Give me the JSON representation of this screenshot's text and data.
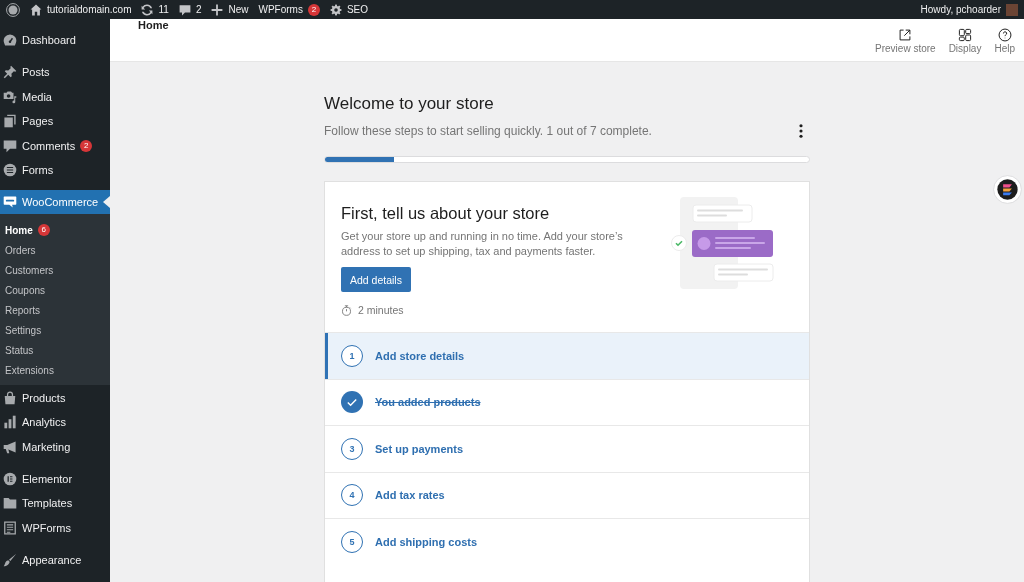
{
  "admin_bar": {
    "site_name": "tutorialdomain.com",
    "updates_count": "11",
    "comments_count": "2",
    "new_label": "New",
    "wpforms": {
      "label": "WPForms",
      "badge": "2"
    },
    "seo_label": "SEO",
    "greeting": "Howdy, pchoarder"
  },
  "sidebar": {
    "groups": [
      {
        "items": [
          {
            "label": "Dashboard",
            "selected": false
          }
        ]
      },
      {
        "items": [
          {
            "label": "Posts",
            "selected": false
          },
          {
            "label": "Media",
            "selected": false
          },
          {
            "label": "Pages",
            "selected": false
          },
          {
            "label": "Comments",
            "selected": false,
            "badge": "2"
          },
          {
            "label": "Forms",
            "selected": false
          }
        ]
      },
      {
        "items": [
          {
            "label": "WooCommerce",
            "selected": true,
            "expanded": true,
            "children": [
              {
                "label": "Home",
                "selected": true,
                "badge": "6"
              },
              {
                "label": "Orders",
                "selected": false
              },
              {
                "label": "Customers",
                "selected": false
              },
              {
                "label": "Coupons",
                "selected": false
              },
              {
                "label": "Reports",
                "selected": false
              },
              {
                "label": "Settings",
                "selected": false
              },
              {
                "label": "Status",
                "selected": false
              },
              {
                "label": "Extensions",
                "selected": false
              }
            ]
          },
          {
            "label": "Products",
            "selected": false
          },
          {
            "label": "Analytics",
            "selected": false
          },
          {
            "label": "Marketing",
            "selected": false
          }
        ]
      },
      {
        "items": [
          {
            "label": "Elementor",
            "selected": false
          },
          {
            "label": "Templates",
            "selected": false
          },
          {
            "label": "WPForms",
            "selected": false
          }
        ]
      },
      {
        "items": [
          {
            "label": "Appearance",
            "selected": false
          }
        ]
      }
    ]
  },
  "header": {
    "title": "Home",
    "actions": [
      {
        "label": "Preview store"
      },
      {
        "label": "Display"
      },
      {
        "label": "Help"
      }
    ]
  },
  "welcome": {
    "title": "Welcome to your store",
    "subtitle": "Follow these steps to start selling quickly. 1 out of 7 complete.",
    "progress": {
      "level": 0.143
    },
    "card": {
      "title": "First, tell us about your store",
      "description": "Get your store up and running in no time. Add your store’s address to set up shipping, tax and payments faster.",
      "button": "Add details",
      "duration": "2 minutes"
    },
    "tasks": [
      {
        "number": "1",
        "label": "Add store details",
        "selected": true,
        "completed": false
      },
      {
        "label": "You added products",
        "selected": false,
        "completed": true
      },
      {
        "number": "3",
        "label": "Set up payments",
        "selected": false,
        "completed": false
      },
      {
        "number": "4",
        "label": "Add tax rates",
        "selected": false,
        "completed": false
      },
      {
        "number": "5",
        "label": "Add shipping costs",
        "selected": false,
        "completed": false
      }
    ]
  }
}
